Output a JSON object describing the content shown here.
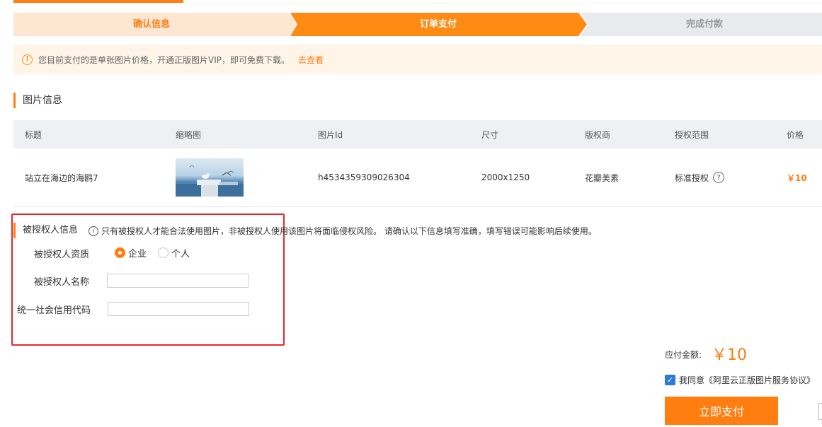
{
  "steps": [
    "确认信息",
    "订单支付",
    "完成付款"
  ],
  "colors": {
    "accent": "#ff7e0f",
    "step_inactive": "#e8eaed",
    "step_done": "#fde6d2",
    "highlight_border": "#e8282b"
  },
  "notice": {
    "text": "您目前支付的是单张图片价格，开通正版图片VIP，即可免费下载。",
    "link": "去查看"
  },
  "image_section": {
    "title": "图片信息",
    "columns": [
      "标题",
      "缩略图",
      "图片Id",
      "尺寸",
      "版权商",
      "授权范围",
      "价格"
    ],
    "row": {
      "title": "站立在海边的海鸥7",
      "image_id": "h4534359309026304",
      "size": "2000x1250",
      "provider": "花瓣美素",
      "license": "标准授权",
      "price": "￥10"
    }
  },
  "licensee": {
    "title": "被授权人信息",
    "note": "只有被授权人才能合法使用图片，非被授权人使用该图片将面临侵权风险。 请确认以下信息填写准确，填写错误可能影响后续使用。",
    "qualification_label": "被授权人资质",
    "options": [
      "企业",
      "个人"
    ],
    "selected": "企业",
    "name_label": "被授权人名称",
    "name_value": "",
    "credit_code_label": "统一社会信用代码",
    "credit_code_value": ""
  },
  "payment": {
    "amount_label": "应付金额:",
    "amount": "￥10",
    "agree_text": "我同意《阿里云正版图片服务协议》",
    "pay_button": "立即支付"
  }
}
